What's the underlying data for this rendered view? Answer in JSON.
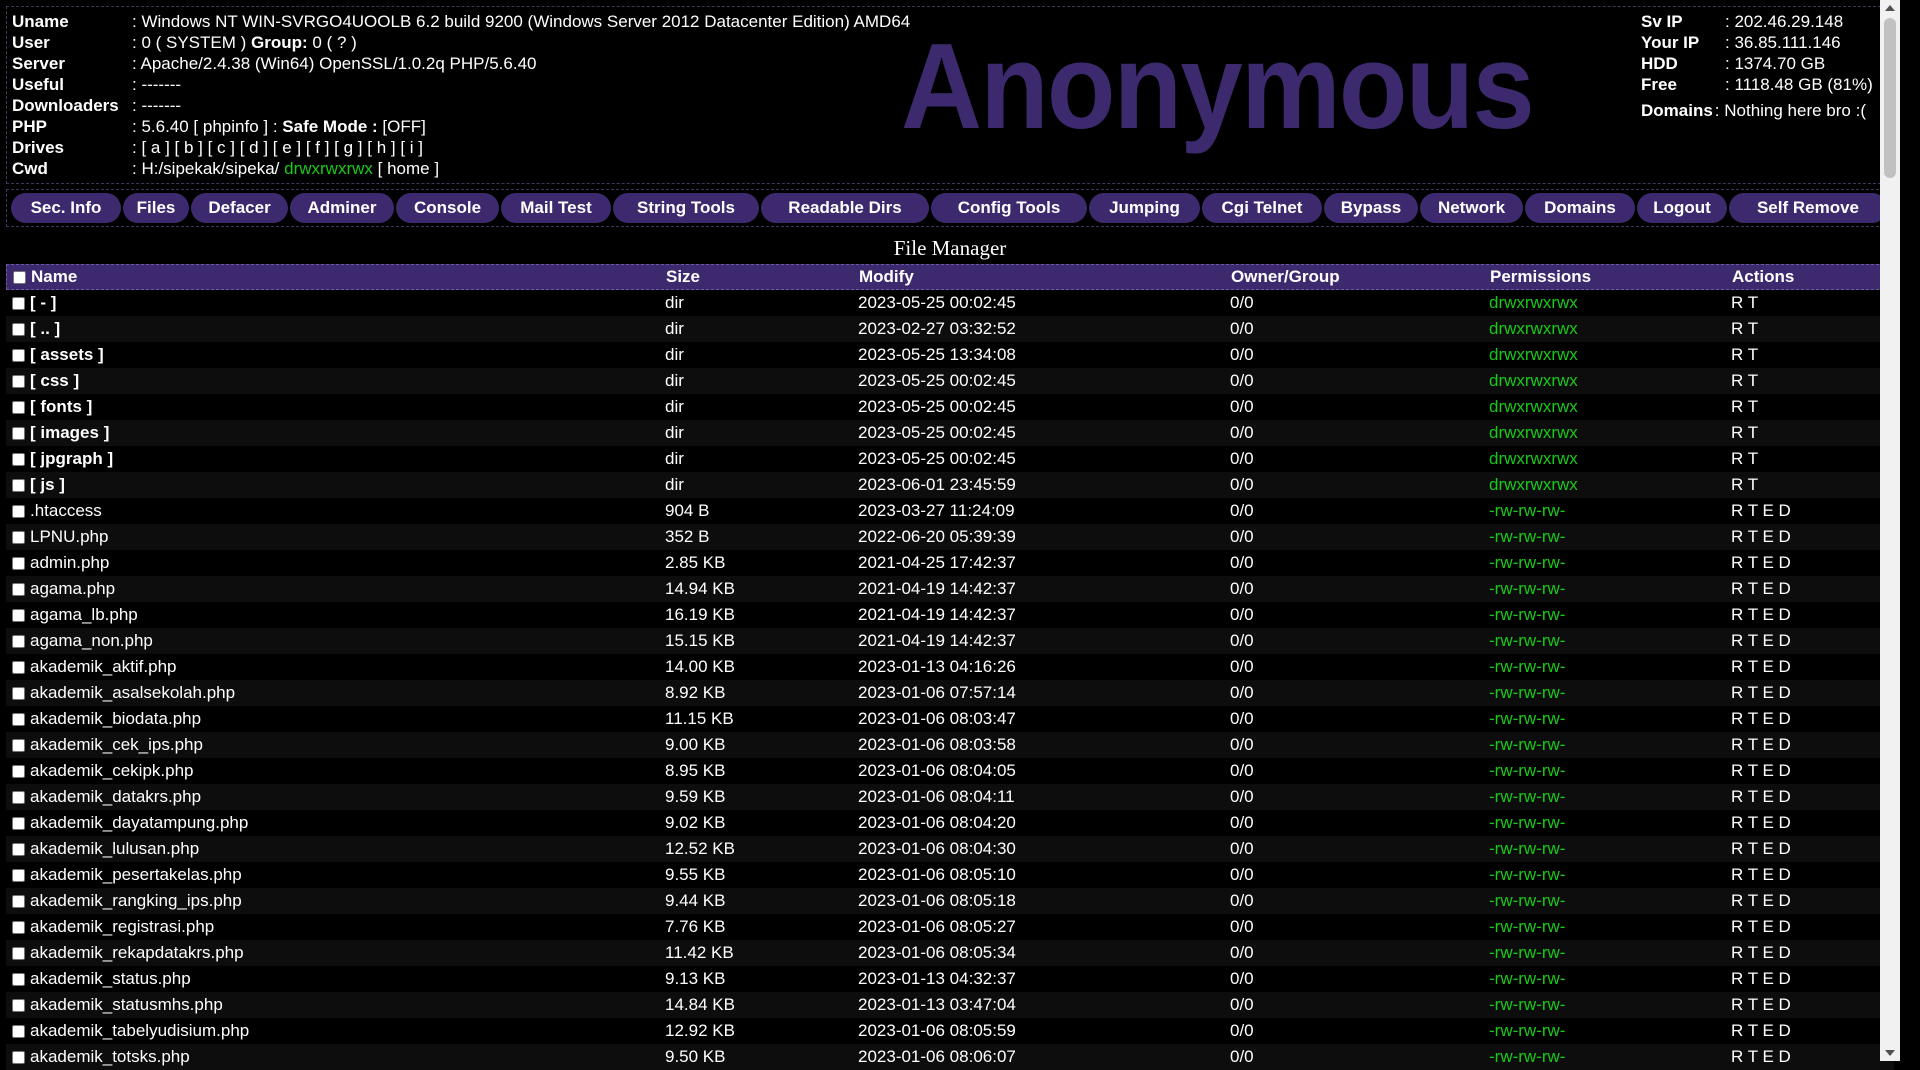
{
  "header": {
    "info": [
      {
        "label": "Uname",
        "value": ": Windows NT WIN-SVRGO4UOOLB 6.2 build 9200 (Windows Server 2012 Datacenter Edition) AMD64"
      },
      {
        "label": "User",
        "value": ": 0 ( SYSTEM ) ",
        "bold_label2": "Group:",
        "value2": " 0 ( ? )"
      },
      {
        "label": "Server",
        "value": ": Apache/2.4.38 (Win64) OpenSSL/1.0.2q PHP/5.6.40"
      },
      {
        "label": "Useful",
        "value": ": -------"
      },
      {
        "label": "Downloaders",
        "value": ": -------"
      },
      {
        "label": "PHP",
        "value": ": 5.6.40 [ phpinfo ] : ",
        "bold_label2": "Safe Mode :",
        "value2": " [OFF]"
      },
      {
        "label": "Drives",
        "value": ": [ a ] [ b ] [ c ] [ d ] [ e ] [ f ] [ g ] [ h ] [ i ]"
      },
      {
        "label": "Cwd",
        "value": ": H:/sipekak/sipeka/ ",
        "perm": "drwxrwxrwx",
        "value2": " [ home ]"
      }
    ],
    "logo": "Anonymous",
    "right_info": [
      {
        "label": "Sv IP",
        "value": ": 202.46.29.148"
      },
      {
        "label": "Your IP",
        "value": ": 36.85.111.146"
      },
      {
        "label": "HDD",
        "value": ": 1374.70 GB"
      },
      {
        "label": "Free",
        "value": ": 1118.48 GB (81%)"
      }
    ],
    "domains_label": "Domains",
    "domains_value": ": Nothing here bro :("
  },
  "menu": [
    {
      "label": "Sec. Info",
      "w": 110
    },
    {
      "label": "Files",
      "w": 66
    },
    {
      "label": "Defacer",
      "w": 97
    },
    {
      "label": "Adminer",
      "w": 104
    },
    {
      "label": "Console",
      "w": 103
    },
    {
      "label": "Mail Test",
      "w": 110
    },
    {
      "label": "String Tools",
      "w": 146
    },
    {
      "label": "Readable Dirs",
      "w": 168
    },
    {
      "label": "Config Tools",
      "w": 156
    },
    {
      "label": "Jumping",
      "w": 111
    },
    {
      "label": "Cgi Telnet",
      "w": 120
    },
    {
      "label": "Bypass",
      "w": 94
    },
    {
      "label": "Network",
      "w": 103
    },
    {
      "label": "Domains",
      "w": 110
    },
    {
      "label": "Logout",
      "w": 90
    },
    {
      "label": "Self Remove",
      "w": 158
    }
  ],
  "file_manager": {
    "title": "File Manager",
    "columns": [
      "Name",
      "Size",
      "Modify",
      "Owner/Group",
      "Permissions",
      "Actions"
    ],
    "rows": [
      {
        "name": "[ - ]",
        "dir": true,
        "size": "dir",
        "modify": "2023-05-25 00:02:45",
        "owner": "0/0",
        "perm": "drwxrwxrwx",
        "actions": "R T"
      },
      {
        "name": "[ .. ]",
        "dir": true,
        "size": "dir",
        "modify": "2023-02-27 03:32:52",
        "owner": "0/0",
        "perm": "drwxrwxrwx",
        "actions": "R T"
      },
      {
        "name": "[ assets ]",
        "dir": true,
        "size": "dir",
        "modify": "2023-05-25 13:34:08",
        "owner": "0/0",
        "perm": "drwxrwxrwx",
        "actions": "R T"
      },
      {
        "name": "[ css ]",
        "dir": true,
        "size": "dir",
        "modify": "2023-05-25 00:02:45",
        "owner": "0/0",
        "perm": "drwxrwxrwx",
        "actions": "R T"
      },
      {
        "name": "[ fonts ]",
        "dir": true,
        "size": "dir",
        "modify": "2023-05-25 00:02:45",
        "owner": "0/0",
        "perm": "drwxrwxrwx",
        "actions": "R T"
      },
      {
        "name": "[ images ]",
        "dir": true,
        "size": "dir",
        "modify": "2023-05-25 00:02:45",
        "owner": "0/0",
        "perm": "drwxrwxrwx",
        "actions": "R T"
      },
      {
        "name": "[ jpgraph ]",
        "dir": true,
        "size": "dir",
        "modify": "2023-05-25 00:02:45",
        "owner": "0/0",
        "perm": "drwxrwxrwx",
        "actions": "R T"
      },
      {
        "name": "[ js ]",
        "dir": true,
        "size": "dir",
        "modify": "2023-06-01 23:45:59",
        "owner": "0/0",
        "perm": "drwxrwxrwx",
        "actions": "R T"
      },
      {
        "name": ".htaccess",
        "dir": false,
        "size": "904 B",
        "modify": "2023-03-27 11:24:09",
        "owner": "0/0",
        "perm": "-rw-rw-rw-",
        "actions": "R T E D"
      },
      {
        "name": "LPNU.php",
        "dir": false,
        "size": "352 B",
        "modify": "2022-06-20 05:39:39",
        "owner": "0/0",
        "perm": "-rw-rw-rw-",
        "actions": "R T E D"
      },
      {
        "name": "admin.php",
        "dir": false,
        "size": "2.85 KB",
        "modify": "2021-04-25 17:42:37",
        "owner": "0/0",
        "perm": "-rw-rw-rw-",
        "actions": "R T E D"
      },
      {
        "name": "agama.php",
        "dir": false,
        "size": "14.94 KB",
        "modify": "2021-04-19 14:42:37",
        "owner": "0/0",
        "perm": "-rw-rw-rw-",
        "actions": "R T E D"
      },
      {
        "name": "agama_lb.php",
        "dir": false,
        "size": "16.19 KB",
        "modify": "2021-04-19 14:42:37",
        "owner": "0/0",
        "perm": "-rw-rw-rw-",
        "actions": "R T E D"
      },
      {
        "name": "agama_non.php",
        "dir": false,
        "size": "15.15 KB",
        "modify": "2021-04-19 14:42:37",
        "owner": "0/0",
        "perm": "-rw-rw-rw-",
        "actions": "R T E D"
      },
      {
        "name": "akademik_aktif.php",
        "dir": false,
        "size": "14.00 KB",
        "modify": "2023-01-13 04:16:26",
        "owner": "0/0",
        "perm": "-rw-rw-rw-",
        "actions": "R T E D"
      },
      {
        "name": "akademik_asalsekolah.php",
        "dir": false,
        "size": "8.92 KB",
        "modify": "2023-01-06 07:57:14",
        "owner": "0/0",
        "perm": "-rw-rw-rw-",
        "actions": "R T E D"
      },
      {
        "name": "akademik_biodata.php",
        "dir": false,
        "size": "11.15 KB",
        "modify": "2023-01-06 08:03:47",
        "owner": "0/0",
        "perm": "-rw-rw-rw-",
        "actions": "R T E D"
      },
      {
        "name": "akademik_cek_ips.php",
        "dir": false,
        "size": "9.00 KB",
        "modify": "2023-01-06 08:03:58",
        "owner": "0/0",
        "perm": "-rw-rw-rw-",
        "actions": "R T E D"
      },
      {
        "name": "akademik_cekipk.php",
        "dir": false,
        "size": "8.95 KB",
        "modify": "2023-01-06 08:04:05",
        "owner": "0/0",
        "perm": "-rw-rw-rw-",
        "actions": "R T E D"
      },
      {
        "name": "akademik_datakrs.php",
        "dir": false,
        "size": "9.59 KB",
        "modify": "2023-01-06 08:04:11",
        "owner": "0/0",
        "perm": "-rw-rw-rw-",
        "actions": "R T E D"
      },
      {
        "name": "akademik_dayatampung.php",
        "dir": false,
        "size": "9.02 KB",
        "modify": "2023-01-06 08:04:20",
        "owner": "0/0",
        "perm": "-rw-rw-rw-",
        "actions": "R T E D"
      },
      {
        "name": "akademik_lulusan.php",
        "dir": false,
        "size": "12.52 KB",
        "modify": "2023-01-06 08:04:30",
        "owner": "0/0",
        "perm": "-rw-rw-rw-",
        "actions": "R T E D"
      },
      {
        "name": "akademik_pesertakelas.php",
        "dir": false,
        "size": "9.55 KB",
        "modify": "2023-01-06 08:05:10",
        "owner": "0/0",
        "perm": "-rw-rw-rw-",
        "actions": "R T E D"
      },
      {
        "name": "akademik_rangking_ips.php",
        "dir": false,
        "size": "9.44 KB",
        "modify": "2023-01-06 08:05:18",
        "owner": "0/0",
        "perm": "-rw-rw-rw-",
        "actions": "R T E D"
      },
      {
        "name": "akademik_registrasi.php",
        "dir": false,
        "size": "7.76 KB",
        "modify": "2023-01-06 08:05:27",
        "owner": "0/0",
        "perm": "-rw-rw-rw-",
        "actions": "R T E D"
      },
      {
        "name": "akademik_rekapdatakrs.php",
        "dir": false,
        "size": "11.42 KB",
        "modify": "2023-01-06 08:05:34",
        "owner": "0/0",
        "perm": "-rw-rw-rw-",
        "actions": "R T E D"
      },
      {
        "name": "akademik_status.php",
        "dir": false,
        "size": "9.13 KB",
        "modify": "2023-01-13 04:32:37",
        "owner": "0/0",
        "perm": "-rw-rw-rw-",
        "actions": "R T E D"
      },
      {
        "name": "akademik_statusmhs.php",
        "dir": false,
        "size": "14.84 KB",
        "modify": "2023-01-13 03:47:04",
        "owner": "0/0",
        "perm": "-rw-rw-rw-",
        "actions": "R T E D"
      },
      {
        "name": "akademik_tabelyudisium.php",
        "dir": false,
        "size": "12.92 KB",
        "modify": "2023-01-06 08:05:59",
        "owner": "0/0",
        "perm": "-rw-rw-rw-",
        "actions": "R T E D"
      },
      {
        "name": "akademik_totsks.php",
        "dir": false,
        "size": "9.50 KB",
        "modify": "2023-01-06 08:06:07",
        "owner": "0/0",
        "perm": "-rw-rw-rw-",
        "actions": "R T E D"
      }
    ]
  },
  "colors": {
    "accent": "#3d2a6e",
    "perm_green": "#18c918",
    "background": "#000000"
  }
}
